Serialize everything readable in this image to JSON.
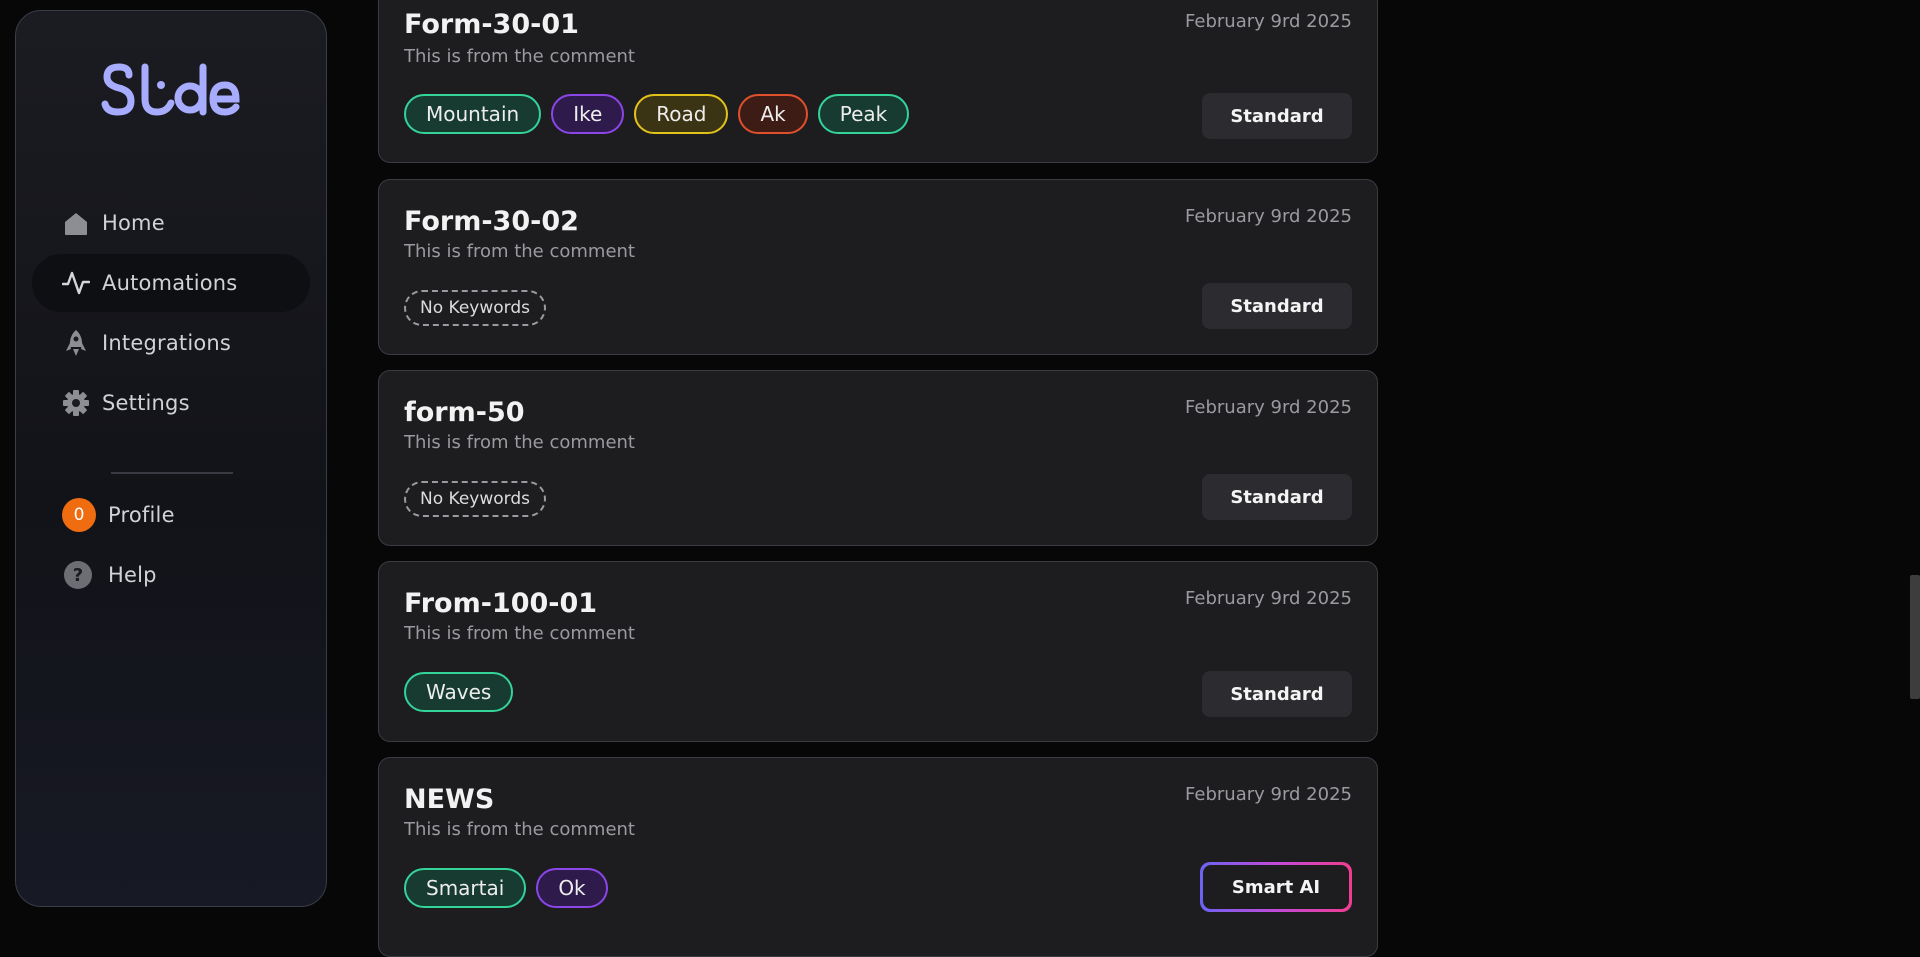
{
  "sidebar": {
    "logo_text": "Slide",
    "nav": [
      {
        "label": "Home",
        "icon": "home-icon"
      },
      {
        "label": "Automations",
        "icon": "automations-icon",
        "active": true
      },
      {
        "label": "Integrations",
        "icon": "rocket-icon"
      },
      {
        "label": "Settings",
        "icon": "gear-icon"
      }
    ],
    "profile": {
      "label": "Profile",
      "avatar_initial": "0",
      "avatar_color": "#ef6d10"
    },
    "help": {
      "label": "Help",
      "icon": "help-icon"
    }
  },
  "cards": [
    {
      "title": "Form-30-01",
      "description": "This is from the comment",
      "date": "February 9rd 2025",
      "tags": [
        {
          "label": "Mountain",
          "color": "green"
        },
        {
          "label": "Ike",
          "color": "purple"
        },
        {
          "label": "Road",
          "color": "yellow"
        },
        {
          "label": "Ak",
          "color": "red"
        },
        {
          "label": "Peak",
          "color": "green"
        }
      ],
      "button": "Standard"
    },
    {
      "title": "Form-30-02",
      "description": "This is from the comment",
      "date": "February 9rd 2025",
      "empty_tag": "No Keywords",
      "button": "Standard"
    },
    {
      "title": "form-50",
      "description": "This is from the comment",
      "date": "February 9rd 2025",
      "empty_tag": "No Keywords",
      "button": "Standard"
    },
    {
      "title": "From-100-01",
      "description": "This is from the comment",
      "date": "February 9rd 2025",
      "tags": [
        {
          "label": "Waves",
          "color": "green"
        }
      ],
      "button": "Standard"
    },
    {
      "title": "NEWS",
      "description": "This is from the comment",
      "date": "February 9rd 2025",
      "tags": [
        {
          "label": "Smartai",
          "color": "green"
        },
        {
          "label": "Ok",
          "color": "purple"
        }
      ],
      "button": "Smart AI"
    }
  ],
  "colors": {
    "accent": "#a8acff",
    "background": "#070707",
    "card": "#1d1d20"
  }
}
